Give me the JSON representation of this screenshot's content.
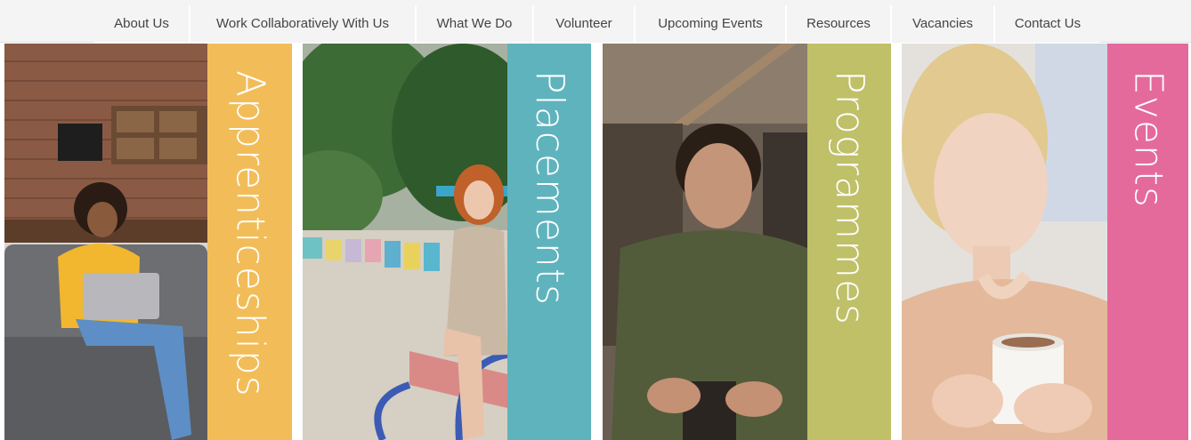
{
  "nav": {
    "items": [
      {
        "label": "About Us"
      },
      {
        "label": "Work Collaboratively With Us"
      },
      {
        "label": "What We Do"
      },
      {
        "label": "Volunteer"
      },
      {
        "label": "Upcoming Events"
      },
      {
        "label": "Resources"
      },
      {
        "label": "Vacancies"
      },
      {
        "label": "Contact Us"
      }
    ]
  },
  "panels": [
    {
      "label": "Apprenticeships",
      "color": "#f2bd59"
    },
    {
      "label": "Placements",
      "color": "#5fb3bd"
    },
    {
      "label": "Programmes",
      "color": "#bfc068"
    },
    {
      "label": "Events",
      "color": "#e56a9c"
    }
  ]
}
